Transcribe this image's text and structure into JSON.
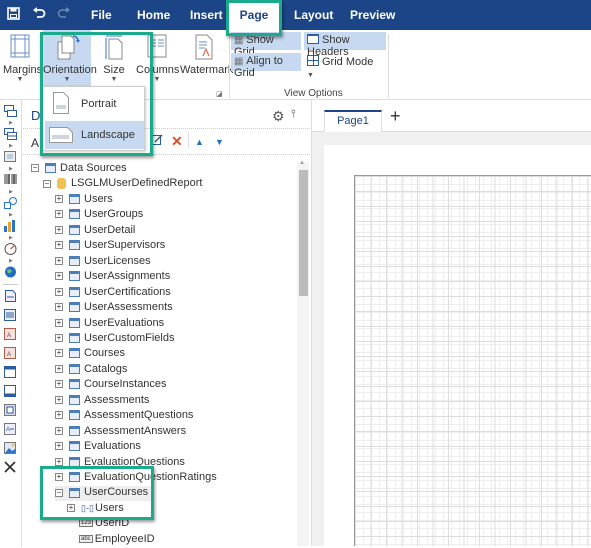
{
  "topbar": {
    "quick_access": [
      {
        "icon": "save-icon",
        "glyph": "▣"
      },
      {
        "icon": "undo-icon",
        "glyph": "↶"
      },
      {
        "icon": "redo-icon",
        "glyph": "↷"
      }
    ],
    "tabs": [
      {
        "label": "File"
      },
      {
        "label": "Home"
      },
      {
        "label": "Insert"
      },
      {
        "label": "Page",
        "active": true
      },
      {
        "label": "Layout"
      },
      {
        "label": "Preview"
      }
    ]
  },
  "ribbon": {
    "page_setup": {
      "margins": "Margins",
      "orientation": "Orientation",
      "size": "Size",
      "columns": "Columns",
      "watermark": "Watermark"
    },
    "view_options": {
      "group_label": "View Options",
      "show_grid": "Show Grid",
      "show_headers": "Show Headers",
      "align_to_grid": "Align to Grid",
      "grid_mode": "Grid Mode"
    }
  },
  "orientation_menu": {
    "items": [
      {
        "label": "Portrait",
        "selected": false
      },
      {
        "label": "Landscape",
        "selected": true
      }
    ]
  },
  "panel": {
    "title": "Data Sources",
    "title_visible": "D",
    "toolbar_visible": "A"
  },
  "tree": {
    "root": "Data Sources",
    "datasource": "LSGLMUserDefinedReport",
    "tables": [
      "Users",
      "UserGroups",
      "UserDetail",
      "UserSupervisors",
      "UserLicenses",
      "UserAssignments",
      "UserCertifications",
      "UserAssessments",
      "UserEvaluations",
      "UserCustomFields",
      "Courses",
      "Catalogs",
      "CourseInstances",
      "Assessments",
      "AssessmentQuestions",
      "AssessmentAnswers",
      "Evaluations",
      "EvaluationQuestions",
      "EvaluationQuestionRatings",
      "UserCourses"
    ],
    "usercourses_children": {
      "relation": "Users",
      "fields": [
        {
          "type": "123",
          "name": "UserID"
        },
        {
          "type": "abc",
          "name": "EmployeeID"
        }
      ]
    }
  },
  "designer": {
    "page_tab": "Page1",
    "add_tab": "+"
  }
}
